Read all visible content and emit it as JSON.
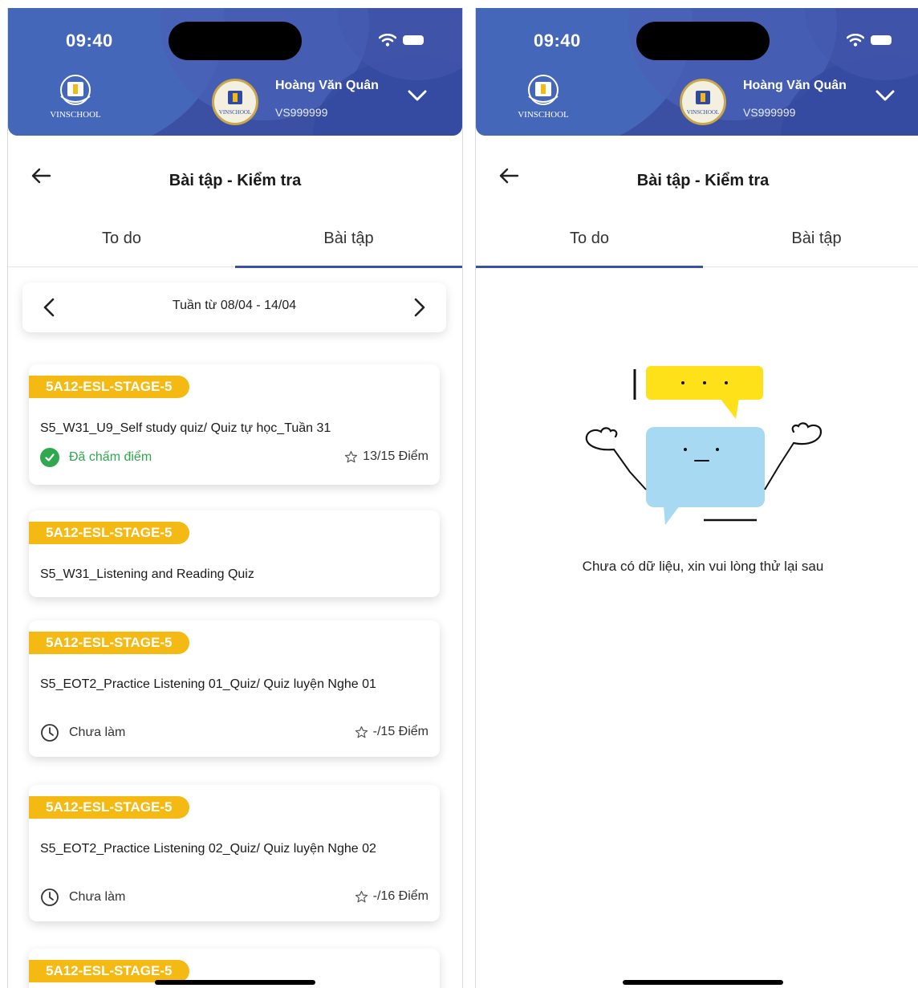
{
  "status_bar": {
    "time": "09:40"
  },
  "header": {
    "logo_text": "VINSCHOOL",
    "avatar_text": "VINSCHOOL",
    "user_name": "Hoàng Văn Quân",
    "user_id": "VS999999"
  },
  "nav": {
    "title": "Bài tập - Kiểm tra"
  },
  "tabs": [
    {
      "label": "To do"
    },
    {
      "label": "Bài tập"
    }
  ],
  "left_screen": {
    "active_tab": "Bài tập",
    "week_label": "Tuần từ 08/04 - 14/04",
    "assignments": [
      {
        "tag": "5A12-ESL-STAGE-5",
        "title": "S5_W31_U9_Self study quiz/ Quiz tự học_Tuần 31",
        "status": "Đã chấm điểm",
        "score": "13/15 Điểm"
      },
      {
        "tag": "5A12-ESL-STAGE-5",
        "title": "S5_W31_Listening and Reading Quiz"
      },
      {
        "tag": "5A12-ESL-STAGE-5",
        "title": "S5_EOT2_Practice Listening 01_Quiz/ Quiz luyện Nghe 01",
        "status": "Chưa làm",
        "score": "-/15 Điểm"
      },
      {
        "tag": "5A12-ESL-STAGE-5",
        "title": "S5_EOT2_Practice Listening 02_Quiz/ Quiz luyện Nghe 02",
        "status": "Chưa làm",
        "score": "-/16 Điểm"
      },
      {
        "tag": "5A12-ESL-STAGE-5"
      }
    ]
  },
  "right_screen": {
    "active_tab": "To do",
    "empty_message": "Chưa có dữ liệu, xin vui lòng thử lại sau"
  },
  "colors": {
    "header_bg": "#3b4fa3",
    "tag_bg": "#f5b914",
    "graded_green": "#2fa84f",
    "tab_underline": "#3b4fa3",
    "bubble_yellow": "#ffe11a",
    "bubble_blue": "#a7d9f2"
  },
  "icons": [
    "back-arrow-icon",
    "chevron-left-icon",
    "chevron-right-icon",
    "chevron-down-icon",
    "check-circle-icon",
    "clock-icon",
    "star-icon",
    "wifi-icon",
    "battery-icon"
  ]
}
